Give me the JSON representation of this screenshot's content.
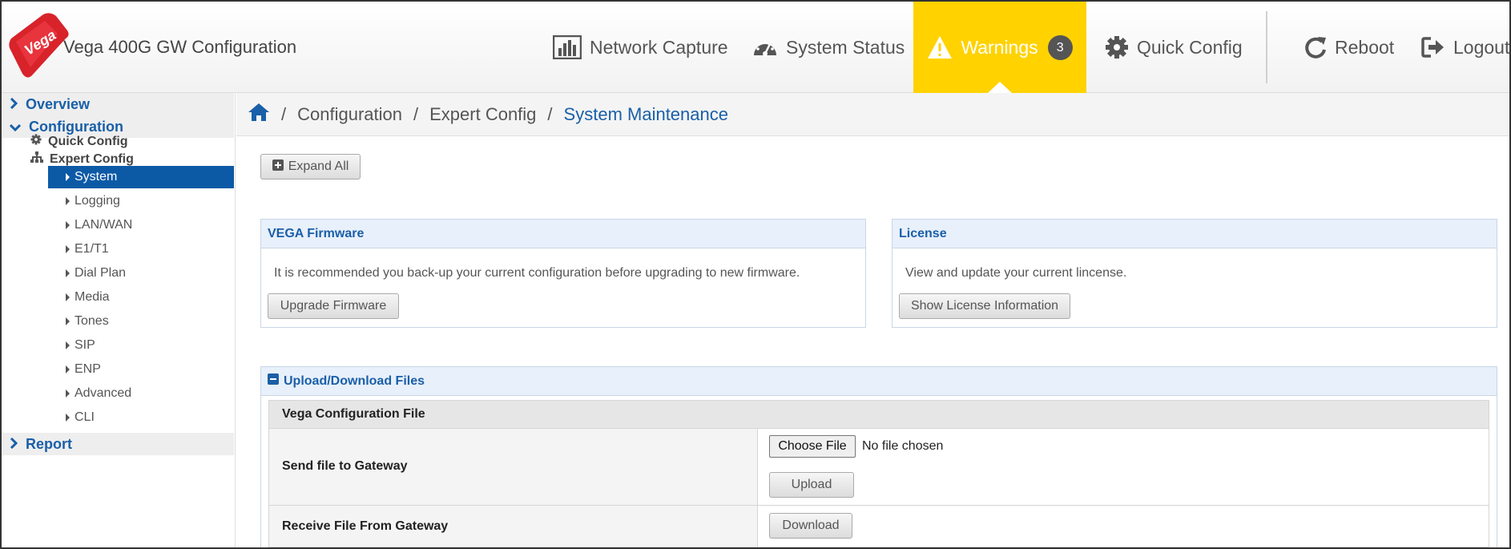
{
  "header": {
    "app_title": "Vega 400G GW Configuration",
    "logo_text": "Vega",
    "nav": {
      "network_capture": "Network Capture",
      "system_status": "System Status",
      "warnings": "Warnings",
      "warnings_count": "3",
      "quick_config": "Quick Config",
      "reboot": "Reboot",
      "logout": "Logout"
    }
  },
  "sidebar": {
    "overview": "Overview",
    "configuration": "Configuration",
    "quick_config": "Quick Config",
    "expert_config": "Expert Config",
    "items": [
      "System",
      "Logging",
      "LAN/WAN",
      "E1/T1",
      "Dial Plan",
      "Media",
      "Tones",
      "SIP",
      "ENP",
      "Advanced",
      "CLI"
    ],
    "active_item": "System",
    "report": "Report"
  },
  "breadcrumb": {
    "sep": "/",
    "items": [
      "Configuration",
      "Expert Config",
      "System Maintenance"
    ]
  },
  "toolbar": {
    "expand_all": "Expand All"
  },
  "firmware_panel": {
    "title": "VEGA Firmware",
    "text": "It is recommended you back-up your current configuration before upgrading to new firmware.",
    "button": "Upgrade Firmware"
  },
  "license_panel": {
    "title": "License",
    "text": "View and update your current lincense.",
    "button": "Show License Information"
  },
  "files_panel": {
    "title": "Upload/Download Files",
    "table_title": "Vega Configuration File",
    "send_label": "Send file to Gateway",
    "choose_file": "Choose File",
    "no_file": "No file chosen",
    "upload": "Upload",
    "receive_label": "Receive File From Gateway",
    "download": "Download"
  },
  "colors": {
    "accent": "#1a5fa8",
    "active": "#0c5aa6",
    "warning": "#ffd200",
    "logo_red": "#d8232a"
  }
}
